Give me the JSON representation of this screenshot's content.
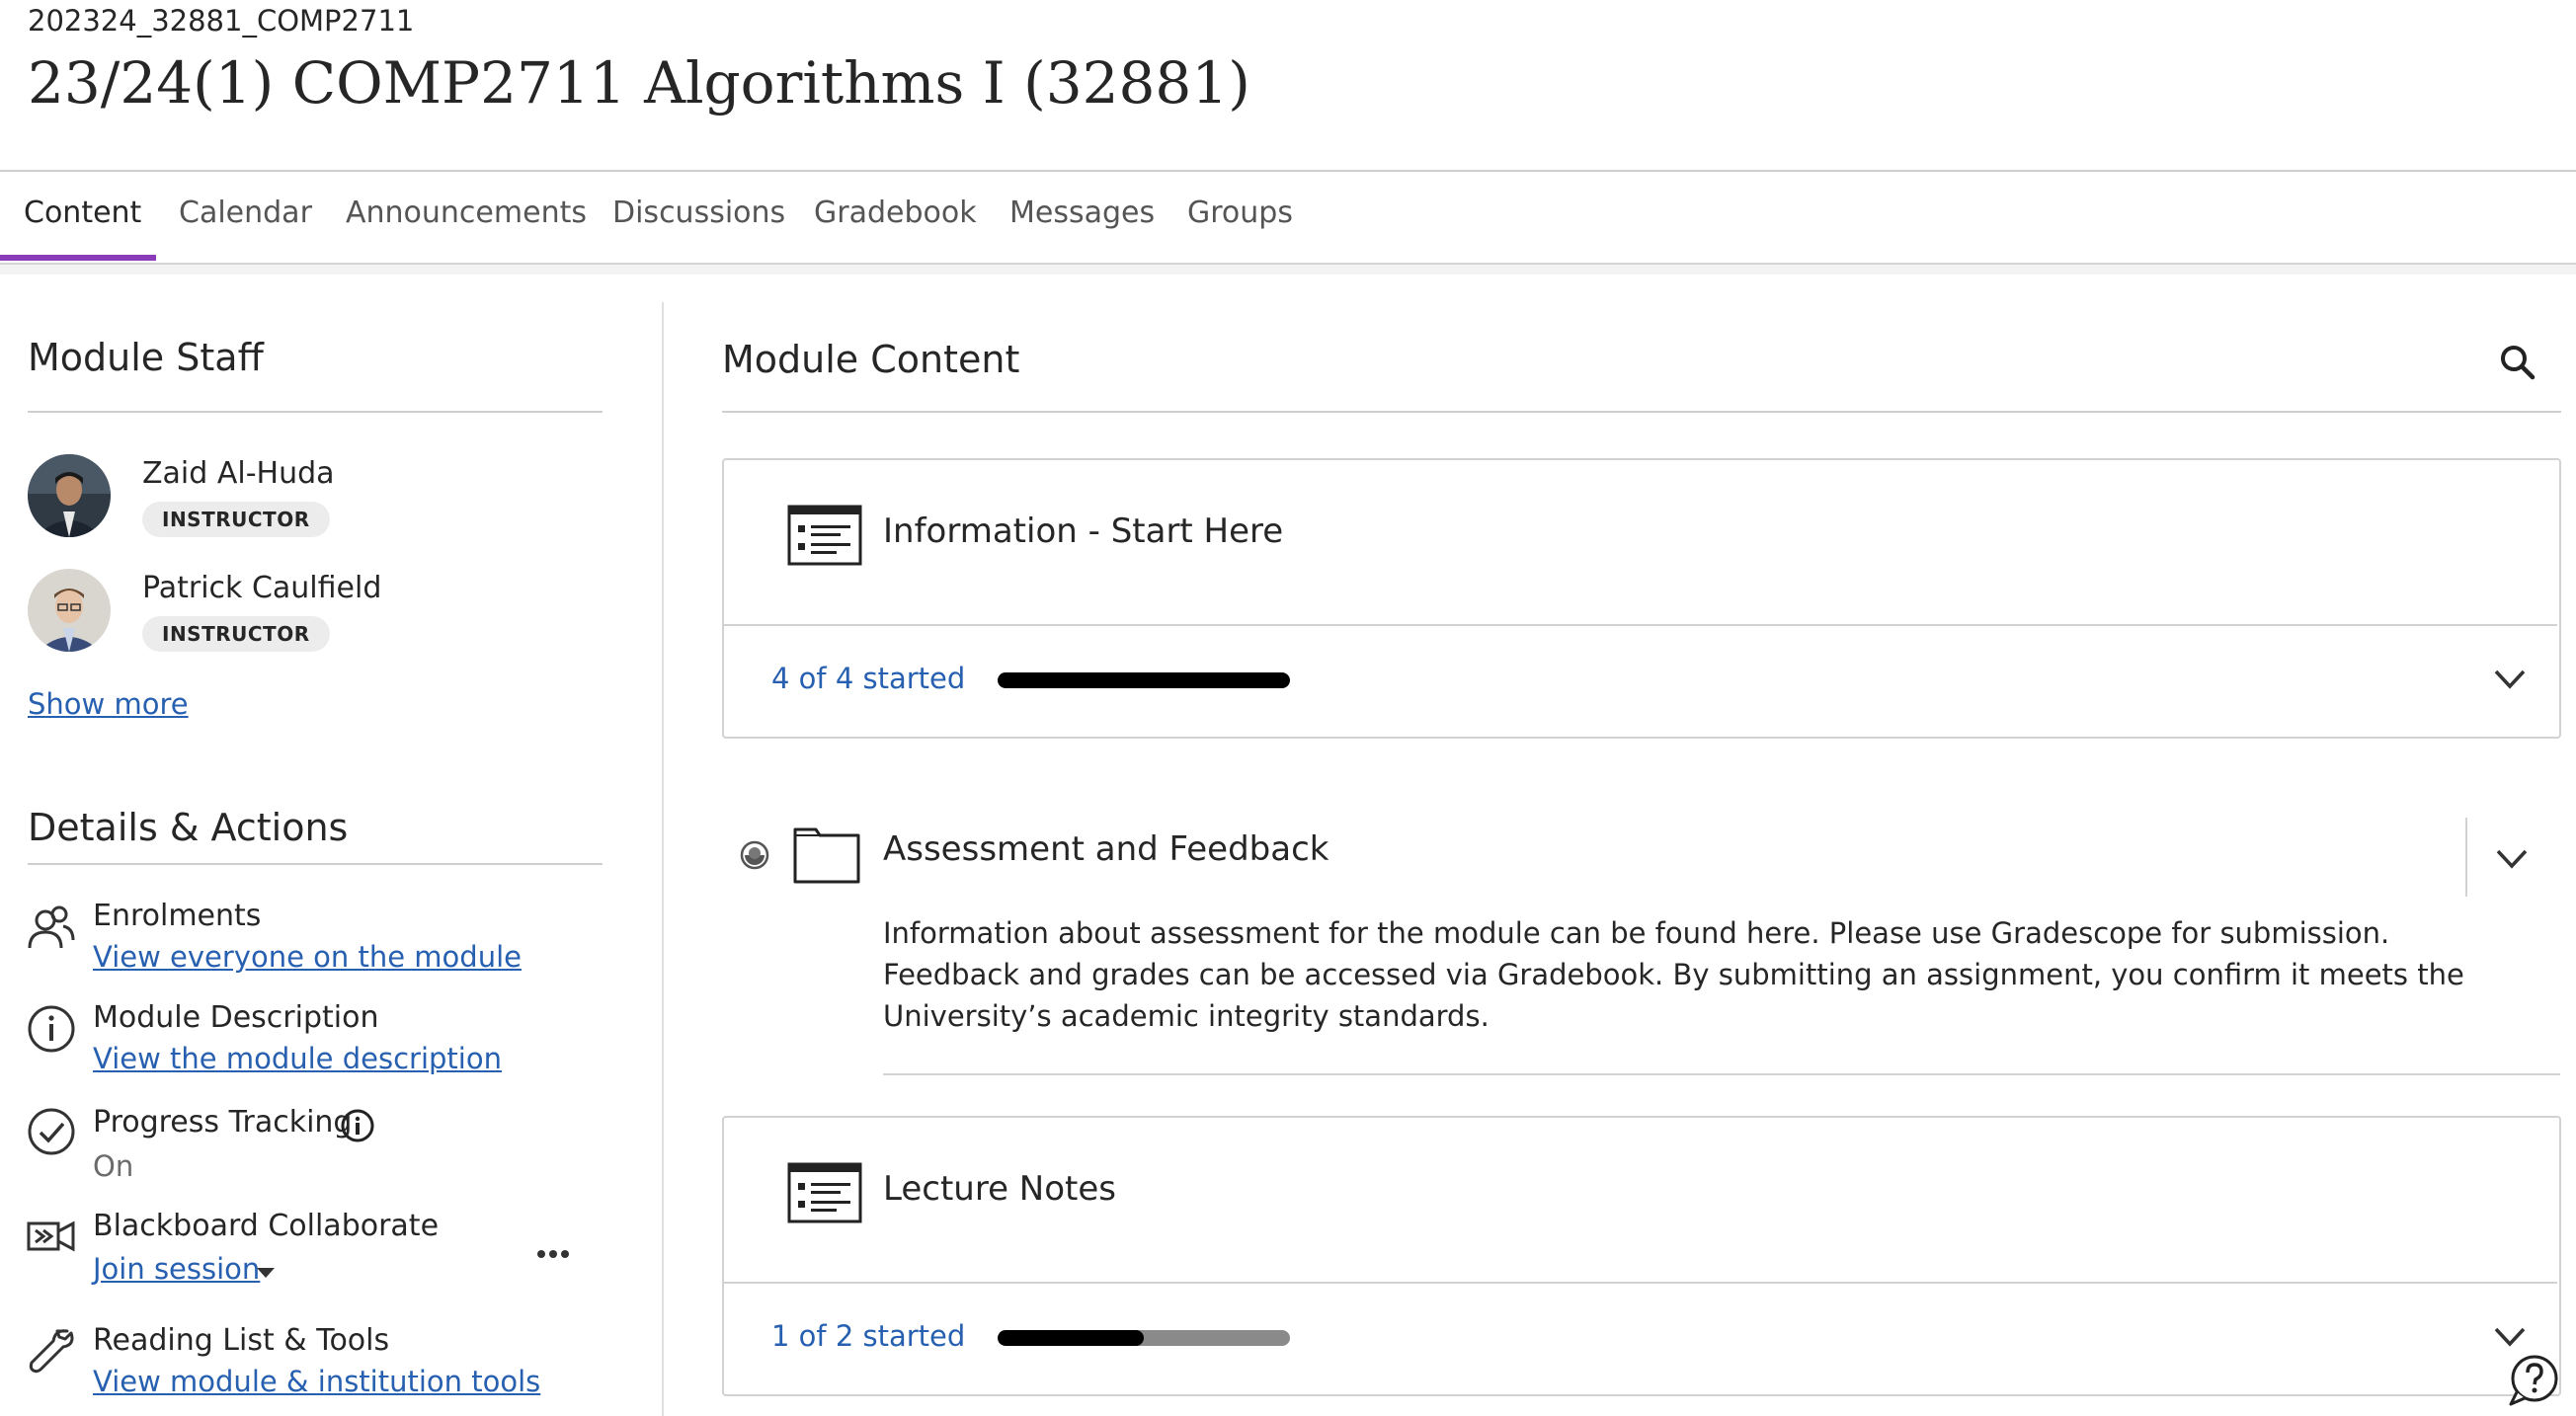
{
  "course": {
    "id": "202324_32881_COMP2711",
    "title": "23/24(1) COMP2711 Algorithms I (32881)"
  },
  "tabs": [
    {
      "label": "Content",
      "active": true
    },
    {
      "label": "Calendar"
    },
    {
      "label": "Announcements"
    },
    {
      "label": "Discussions"
    },
    {
      "label": "Gradebook"
    },
    {
      "label": "Messages"
    },
    {
      "label": "Groups"
    }
  ],
  "staff": {
    "heading": "Module Staff",
    "members": [
      {
        "name": "Zaid Al-Huda",
        "role": "INSTRUCTOR"
      },
      {
        "name": "Patrick Caulfield",
        "role": "INSTRUCTOR"
      }
    ],
    "show_more": "Show more"
  },
  "details": {
    "heading": "Details & Actions",
    "enrolments": {
      "label": "Enrolments",
      "link": "View everyone on the module"
    },
    "description": {
      "label": "Module Description",
      "link": "View the module description"
    },
    "progress": {
      "label": "Progress Tracking",
      "value": "On"
    },
    "collaborate": {
      "label": "Blackboard Collaborate",
      "link": "Join session"
    },
    "reading": {
      "label": "Reading List & Tools",
      "link": "View module & institution tools"
    }
  },
  "content": {
    "heading": "Module Content",
    "items": [
      {
        "title": "Information - Start Here",
        "progress_text": "4 of 4 started",
        "progress": 1.0
      },
      {
        "title": "Assessment and Feedback",
        "description": "Information about assessment for the module can be found here. Please use Gradescope for submission. Feedback and grades can be accessed via Gradebook. By submitting an assignment, you confirm it meets the University’s academic integrity standards."
      },
      {
        "title": "Lecture Notes",
        "progress_text": "1 of 2 started",
        "progress": 0.5
      }
    ]
  },
  "colors": {
    "accent": "#8a3bb7",
    "link": "#2760b0"
  }
}
